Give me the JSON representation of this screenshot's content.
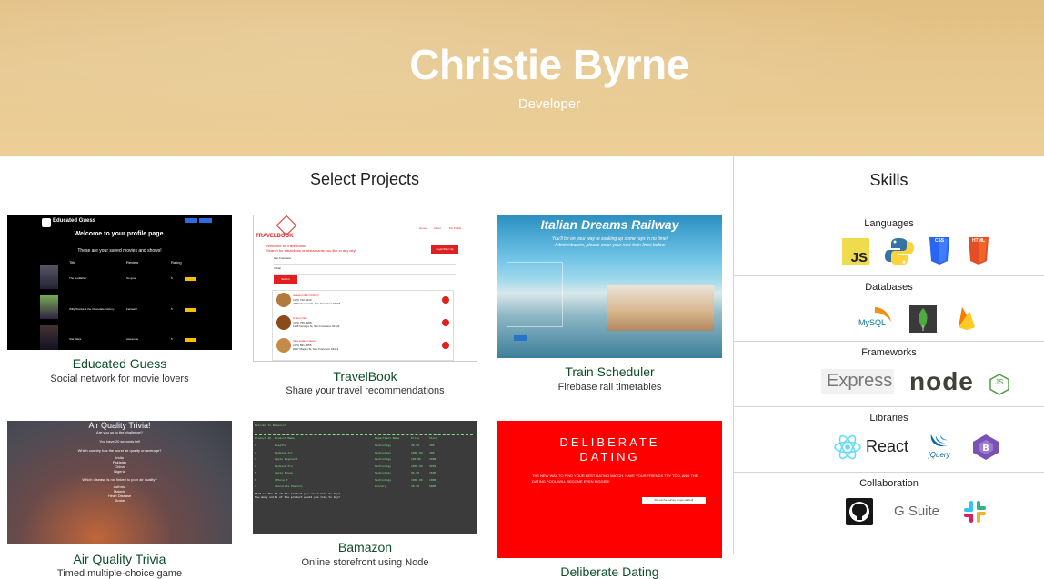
{
  "hero": {
    "name": "Christie Byrne",
    "role": "Developer"
  },
  "projects": {
    "title": "Select Projects",
    "items": [
      {
        "title": "Educated Guess",
        "desc": "Social network for movie lovers",
        "thumb": {
          "brand": "Educated Guess",
          "heading": "Welcome to your profile page.",
          "sub": "These are your saved movies and shows!",
          "cols": [
            "Title",
            "Review",
            "Rating"
          ],
          "rows": [
            [
              "The Godfather",
              "So good",
              "5"
            ],
            [
              "Willy Wonka & the Chocolate Factory",
              "Fantastic",
              "5"
            ],
            [
              "Star Wars",
              "Awesome",
              "5"
            ]
          ]
        }
      },
      {
        "title": "TravelBook",
        "desc": "Share your travel recommendations",
        "thumb": {
          "brand": "TRAVELBOOK",
          "welcome": "Welcome to TravelBook!",
          "search": "Search for attractions or restaurants you like in any city!",
          "city": "San Francisco",
          "type": "Indian",
          "submit": "Submit",
          "login": "Login/Sign Up",
          "nav": [
            "Home",
            "About",
            "My Profile"
          ],
          "results": [
            [
              "Aaaaa Indian Kitchen",
              "(415) 742-4233",
              "4040 Clement St, San Francisco 94118"
            ],
            [
              "A Best Cafe",
              "(415) 759-9088",
              "1106 Noriega St, San Francisco 94122"
            ],
            [
              "Tara Indian Cuisine",
              "(415) 861-8655",
              "2007 Market St, San Francisco 94114"
            ]
          ]
        }
      },
      {
        "title": "Train Scheduler",
        "desc": "Firebase rail timetables",
        "thumb": {
          "heading": "Italian Dreams Railway",
          "sub1": "You'll be on your way to soaking up some rays in no time!",
          "sub2": "Administrators, please enter your new train lines below"
        }
      },
      {
        "title": "Air Quality Trivia",
        "desc": "Timed multiple-choice game",
        "thumb": {
          "heading": "Air Quality Trivia!",
          "line1": "Are you up to the challenge?",
          "timer": "You have 20 seconds left",
          "q1": "Which country has the worst air quality on average?",
          "a1": [
            "India",
            "Pakistan",
            "China",
            "Nigeria"
          ],
          "q2": "Which disease is not linked to poor air quality?",
          "a2": [
            "Asthma",
            "Malaria",
            "Heart Disease",
            "Stroke"
          ]
        }
      },
      {
        "title": "Bamazon",
        "desc": "Online storefront using Node",
        "thumb": {
          "line1": "Welcome to Bamazon!",
          "cols": [
            "Product ID",
            "Product Name",
            "Department Name",
            "Price",
            "Stock"
          ],
          "rows": [
            [
              "1",
              "Rosetta",
              "Technology",
              "99.00",
              "100"
            ],
            [
              "2",
              "Macbook Air",
              "Technology",
              "1000.00",
              "100"
            ],
            [
              "3",
              "Apple Keyboard",
              "Technology",
              "100.00",
              "1000"
            ],
            [
              "4",
              "Macbook Pro",
              "Technology",
              "1600.00",
              "4999"
            ],
            [
              "5",
              "Apple Mouse",
              "Technology",
              "99.00",
              "1500"
            ],
            [
              "6",
              "iPhone X",
              "Technology",
              "1000.00",
              "1000"
            ],
            [
              "7",
              "Chocolate Peanuts",
              "Grocery",
              "30.00",
              "5000"
            ]
          ],
          "prompt1": "What is the ID of the product you would like to buy?",
          "prompt2": "How many units of the product would you like to buy?"
        }
      },
      {
        "title": "Deliberate Dating",
        "desc": "",
        "thumb": {
          "logo1": "DELIBERATE",
          "logo2": "DATING",
          "tag": "THE NEW WAY TO FIND YOUR BEST DATING MATCH. HAVE YOUR FRIENDS TRY TOO, AND THE DATING POOL WILL BECOME EVEN BIGGER!",
          "cta": "Fill out the survey to get started!"
        }
      }
    ]
  },
  "skills": {
    "title": "Skills",
    "groups": [
      {
        "label": "Languages",
        "icons": [
          "javascript-icon",
          "python-icon",
          "css3-icon",
          "html5-icon"
        ]
      },
      {
        "label": "Databases",
        "icons": [
          "mysql-icon",
          "mongodb-icon",
          "firebase-icon"
        ]
      },
      {
        "label": "Frameworks",
        "icons": [
          "express-icon",
          "nodejs-icon"
        ]
      },
      {
        "label": "Libraries",
        "icons": [
          "react-icon",
          "jquery-icon",
          "bootstrap-icon"
        ]
      },
      {
        "label": "Collaboration",
        "icons": [
          "github-icon",
          "gsuite-icon",
          "slack-icon"
        ]
      }
    ],
    "logo_text": {
      "js": "JS",
      "css": "CSS",
      "html": "HTML",
      "mysql": "MySQL",
      "express": "Express",
      "node": "node",
      "nodejs": "JS",
      "react": "React",
      "jquery": "jQuery",
      "gsuite": "G Suite"
    }
  },
  "colors": {
    "title_green": "#0c4d2a",
    "hero": "#e6c58c",
    "dating_red": "#ff0000"
  }
}
